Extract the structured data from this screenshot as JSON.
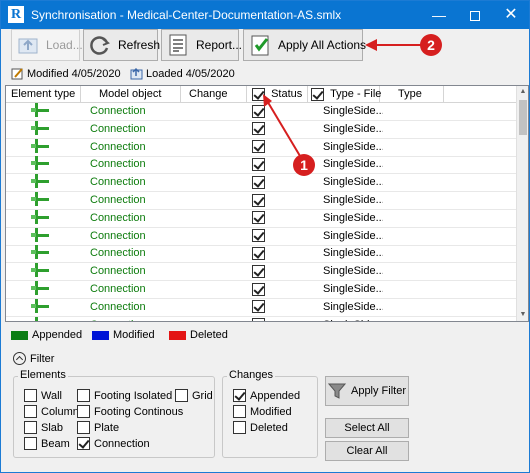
{
  "window": {
    "title": "Synchronisation - Medical-Center-Documentation-AS.smlx",
    "app_icon": "R"
  },
  "toolbar": {
    "load_label": "Load...",
    "refresh_label": "Refresh",
    "report_label": "Report...",
    "apply_all_label": "Apply All Actions"
  },
  "info": {
    "modified": "Modified 4/05/2020",
    "loaded": "Loaded 4/05/2020"
  },
  "grid": {
    "headers": {
      "element_type": "Element type",
      "model_object": "Model object",
      "change": "Change",
      "status": "Status",
      "type_file": "Type - File",
      "type": "Type"
    },
    "rows": [
      {
        "model_object": "Connection",
        "status_checked": true,
        "type_file": "SingleSide..."
      },
      {
        "model_object": "Connection",
        "status_checked": true,
        "type_file": "SingleSide..."
      },
      {
        "model_object": "Connection",
        "status_checked": true,
        "type_file": "SingleSide..."
      },
      {
        "model_object": "Connection",
        "status_checked": true,
        "type_file": "SingleSide..."
      },
      {
        "model_object": "Connection",
        "status_checked": true,
        "type_file": "SingleSide..."
      },
      {
        "model_object": "Connection",
        "status_checked": true,
        "type_file": "SingleSide..."
      },
      {
        "model_object": "Connection",
        "status_checked": true,
        "type_file": "SingleSide..."
      },
      {
        "model_object": "Connection",
        "status_checked": true,
        "type_file": "SingleSide..."
      },
      {
        "model_object": "Connection",
        "status_checked": true,
        "type_file": "SingleSide..."
      },
      {
        "model_object": "Connection",
        "status_checked": true,
        "type_file": "SingleSide..."
      },
      {
        "model_object": "Connection",
        "status_checked": true,
        "type_file": "SingleSide..."
      },
      {
        "model_object": "Connection",
        "status_checked": true,
        "type_file": "SingleSide..."
      },
      {
        "model_object": "Connection",
        "status_checked": true,
        "type_file": "SingleSide..."
      }
    ]
  },
  "legend": {
    "appended": {
      "label": "Appended",
      "color": "#0b7d14"
    },
    "modified": {
      "label": "Modified",
      "color": "#0015d6"
    },
    "deleted": {
      "label": "Deleted",
      "color": "#e31414"
    }
  },
  "filter": {
    "toggle_label": "Filter",
    "elements": {
      "title": "Elements",
      "wall": "Wall",
      "column": "Column",
      "slab": "Slab",
      "beam": "Beam",
      "footing_isolated": "Footing Isolated",
      "footing_continous": "Footing Continous",
      "plate": "Plate",
      "connection": "Connection",
      "grid": "Grid"
    },
    "changes": {
      "title": "Changes",
      "appended": "Appended",
      "modified": "Modified",
      "deleted": "Deleted"
    },
    "apply_filter_label": "Apply Filter",
    "select_all_label": "Select All",
    "clear_all_label": "Clear All"
  },
  "annotations": {
    "badge1": "1",
    "badge2": "2",
    "color": "#d61f1f"
  }
}
